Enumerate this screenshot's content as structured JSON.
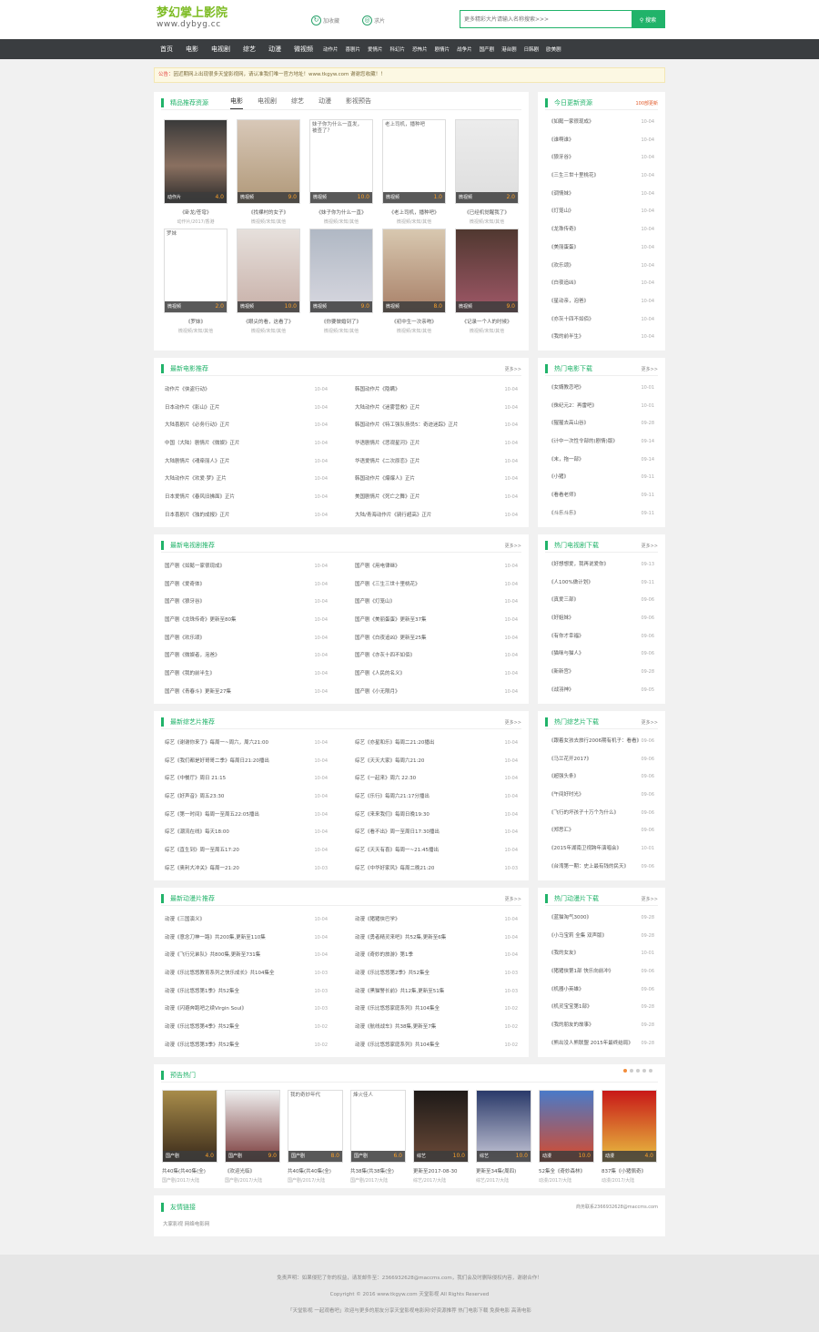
{
  "header": {
    "logo_cn": "梦幻掌上影院",
    "logo_url": "www.dybyg.cc",
    "link1": "加收藏",
    "link2": "求片",
    "search_placeholder": "更多精彩大片请输入名称搜索>>>",
    "search_btn": "搜索"
  },
  "nav": {
    "main": [
      "首页",
      "电影",
      "电视剧",
      "综艺",
      "动漫",
      "微视频"
    ],
    "sub": [
      "动作片",
      "喜剧片",
      "爱情片",
      "科幻片",
      "恐怖片",
      "剧情片",
      "战争片",
      "国产剧",
      "港台剧",
      "日韩剧",
      "欧美剧"
    ]
  },
  "notice": {
    "label": "公告：",
    "text": "因近期网上出现很多天堂影视网，请认准我们唯一官方地址！www.tkgyw.com 谢谢您收藏！！"
  },
  "rec": {
    "title": "精品推荐资源",
    "tabs": [
      "电影",
      "电视剧",
      "综艺",
      "动漫",
      "影视预告"
    ],
    "items": [
      {
        "type": "动作片",
        "score": "4.0",
        "name": "《卧龙/苍穹》",
        "actor": "动作片/2017/香港"
      },
      {
        "type": "微视频",
        "score": "9.0",
        "name": "《找裸村的女子》",
        "actor": "微视频/未知/其他"
      },
      {
        "type": "微视频",
        "score": "10.0",
        "name": "《妹子你为什么一直》",
        "actor": "微视频/未知/其他",
        "alt": "妹子你为什么一直发，被查了？"
      },
      {
        "type": "微视频",
        "score": "1.0",
        "name": "《老上司机，播种吧》",
        "actor": "微视频/未知/其他",
        "alt": "老上司机，播种吧"
      },
      {
        "type": "微视频",
        "score": "2.0",
        "name": "《已经机觉醒我了》",
        "actor": "微视频/未知/其他"
      },
      {
        "type": "微视频",
        "score": "2.0",
        "name": "《罗妹》",
        "actor": "微视频/未知/其他",
        "alt": "罗妹"
      },
      {
        "type": "微视频",
        "score": "10.0",
        "name": "《眼尖的看，这看了》",
        "actor": "微视频/未知/其他"
      },
      {
        "type": "微视频",
        "score": "9.0",
        "name": "《你要做婚到了》",
        "actor": "微视频/未知/其他"
      },
      {
        "type": "微视频",
        "score": "8.0",
        "name": "《初中生一次亲吻》",
        "actor": "微视频/未知/其他"
      },
      {
        "type": "微视频",
        "score": "9.0",
        "name": "《记录一个人的时候》",
        "actor": "微视频/未知/其他"
      }
    ]
  },
  "today": {
    "title": "今日更新资源",
    "count": "100部更新",
    "items": [
      {
        "n": "《如懿一家很现成》",
        "d": "10-04"
      },
      {
        "n": "《谁啊谁》",
        "d": "10-04"
      },
      {
        "n": "《狼牙谷》",
        "d": "10-04"
      },
      {
        "n": "《三生三世十里桃花》",
        "d": "10-04"
      },
      {
        "n": "《调情妹》",
        "d": "10-04"
      },
      {
        "n": "《灯笼山》",
        "d": "10-04"
      },
      {
        "n": "《龙珠传奇》",
        "d": "10-04"
      },
      {
        "n": "《美丽蛋蛋》",
        "d": "10-04"
      },
      {
        "n": "《欢乐颂》",
        "d": "10-04"
      },
      {
        "n": "《白夜追凶》",
        "d": "10-04"
      },
      {
        "n": "《星动亲，泡爸》",
        "d": "10-04"
      },
      {
        "n": "《亦灰十四不如佰》",
        "d": "10-04"
      },
      {
        "n": "《我的前半生》",
        "d": "10-04"
      }
    ]
  },
  "movie": {
    "title": "最新电影推荐",
    "more": "更多>>",
    "items": [
      {
        "n": "动作片《侠盗行动》",
        "d": "10-04"
      },
      {
        "n": "韩国动作片《隐瞒》",
        "d": "10-04"
      },
      {
        "n": "日本动作片《影山》正片",
        "d": "10-04"
      },
      {
        "n": "大陆动作片《迷雾营救》正片",
        "d": "10-04"
      },
      {
        "n": "大陆喜剧片《必务行动》正片",
        "d": "10-04"
      },
      {
        "n": "韩国动作片《特工强队扬员5：奇迹迷踪》正片",
        "d": "10-04"
      },
      {
        "n": "中国（大陆）剧情片《微娱》正片",
        "d": "10-04"
      },
      {
        "n": "华语剧情片《悲观星河》正片",
        "d": "10-04"
      },
      {
        "n": "大陆剧情片《魂牵丽人》正片",
        "d": "10-04"
      },
      {
        "n": "华语爱情片《二次原恋》正片",
        "d": "10-04"
      },
      {
        "n": "大陆动作片《欢爱·梦》正片",
        "d": "10-04"
      },
      {
        "n": "韩国动作片《爆爆人》正片",
        "d": "10-04"
      },
      {
        "n": "日本爱情片《春风旧拂面》正片",
        "d": "10-04"
      },
      {
        "n": "美国剧情片《死亡之舞》正片",
        "d": "10-04"
      },
      {
        "n": "日本喜剧片《独的成报》正片",
        "d": "10-04"
      },
      {
        "n": "大陆/青海动作片《骑行超高》正片",
        "d": "10-04"
      }
    ]
  },
  "movieHot": {
    "title": "热门电影下载",
    "more": "更多>>",
    "items": [
      {
        "n": "《女婿教恋吧》",
        "d": "10-01"
      },
      {
        "n": "《侏纪元2：再雷吧》",
        "d": "10-01"
      },
      {
        "n": "《猩猩去高山谷》",
        "d": "09-28"
      },
      {
        "n": "《计中一次性令部的(剧情)版》",
        "d": "09-14"
      },
      {
        "n": "《末，拖一部》",
        "d": "09-14"
      },
      {
        "n": "《小猪》",
        "d": "09-11"
      },
      {
        "n": "《看看老师》",
        "d": "09-11"
      },
      {
        "n": "《斗乐斗乐》",
        "d": "09-11"
      }
    ]
  },
  "tv": {
    "title": "最新电视剧推荐",
    "more": "更多>>",
    "items": [
      {
        "n": "国产剧《如懿一家很现成》",
        "d": "10-04"
      },
      {
        "n": "国产剧《用电律继》",
        "d": "10-04"
      },
      {
        "n": "国产剧《爱奇体》",
        "d": "10-04"
      },
      {
        "n": "国产剧《三生三世十里桃花》",
        "d": "10-04"
      },
      {
        "n": "国产剧《狼牙谷》",
        "d": "10-04"
      },
      {
        "n": "国产剧《灯笼山》",
        "d": "10-04"
      },
      {
        "n": "国产剧《龙珠传奇》更新至80集",
        "d": "10-04"
      },
      {
        "n": "国产剧《美丽蛋蛋》更新至37集",
        "d": "10-04"
      },
      {
        "n": "国产剧《欢乐颂》",
        "d": "10-04"
      },
      {
        "n": "国产剧《白夜追凶》更新至25集",
        "d": "10-04"
      },
      {
        "n": "国产剧《微娱者，泡爸》",
        "d": "10-04"
      },
      {
        "n": "国产剧《亦灰十四不如佰》",
        "d": "10-04"
      },
      {
        "n": "国产剧《我的前半生》",
        "d": "10-04"
      },
      {
        "n": "国产剧《人民的名义》",
        "d": "10-04"
      },
      {
        "n": "国产剧《青春斗》更新至27集",
        "d": "10-04"
      },
      {
        "n": "国产剧《小无限月》",
        "d": "10-04"
      }
    ]
  },
  "tvHot": {
    "title": "热门电视剧下载",
    "more": "更多>>",
    "items": [
      {
        "n": "《好想想爱，我再说爱你》",
        "d": "09-13"
      },
      {
        "n": "《人100%做计划》",
        "d": "09-11"
      },
      {
        "n": "《真爱三部》",
        "d": "09-06"
      },
      {
        "n": "《好姐妹》",
        "d": "09-06"
      },
      {
        "n": "《有你才幸福》",
        "d": "09-06"
      },
      {
        "n": "《猫咪与猫人》",
        "d": "09-06"
      },
      {
        "n": "《新新宫》",
        "d": "09-28"
      },
      {
        "n": "《战羽神》",
        "d": "09-05"
      }
    ]
  },
  "variety": {
    "title": "最新综艺片推荐",
    "more": "更多>>",
    "items": [
      {
        "n": "综艺《谢谢你来了》每周一~周六，周六21:00",
        "d": "10-04"
      },
      {
        "n": "综艺《亦星和乐》每周二21:20播出",
        "d": "10-04"
      },
      {
        "n": "综艺《我们都是好哥哥二季》每周日21:20播出",
        "d": "10-04"
      },
      {
        "n": "综艺《天天大家》每周六21:20",
        "d": "10-04"
      },
      {
        "n": "综艺《中餐厅》周日 21:15",
        "d": "10-04"
      },
      {
        "n": "综艺《一起来》周六 22:30",
        "d": "10-04"
      },
      {
        "n": "综艺《好声音》周五23:30",
        "d": "10-04"
      },
      {
        "n": "综艺《乐行》每周六21:17分播出",
        "d": "10-04"
      },
      {
        "n": "综艺《第一时间》每周一至周五22:05播出",
        "d": "10-04"
      },
      {
        "n": "综艺《来来我们》每周日晚19:30",
        "d": "10-04"
      },
      {
        "n": "综艺《潮流在线》每天18:00",
        "d": "10-04"
      },
      {
        "n": "综艺《看不出》周一至周日17:30播出",
        "d": "10-04"
      },
      {
        "n": "综艺《直生到》周一至周五17:20",
        "d": "10-04"
      },
      {
        "n": "综艺《天天有喜》每周一~21:45播出",
        "d": "10-04"
      },
      {
        "n": "综艺《奥利大冲关》每周一21:20",
        "d": "10-03"
      },
      {
        "n": "综艺《中华好家风》每周二晚21:20",
        "d": "10-03"
      }
    ]
  },
  "varietyHot": {
    "title": "热门综艺片下载",
    "more": "更多>>",
    "items": [
      {
        "n": "《跟着女孩去旅行2006期有机子：看看》",
        "d": "09-06"
      },
      {
        "n": "《马兰花开2017》",
        "d": "09-06"
      },
      {
        "n": "《超强头条》",
        "d": "09-06"
      },
      {
        "n": "《午间好时光》",
        "d": "09-06"
      },
      {
        "n": "《飞行的坏孩子十万个为什么》",
        "d": "09-06"
      },
      {
        "n": "《郑思汇》",
        "d": "09-06"
      },
      {
        "n": "《2015年湖南卫视跨年演唱会》",
        "d": "10-01"
      },
      {
        "n": "《台湾第一期：史上最有钱的民天》",
        "d": "09-06"
      }
    ]
  },
  "anime": {
    "title": "最新动漫片推荐",
    "more": "更多>>",
    "items": [
      {
        "n": "动漫《三国演义》",
        "d": "10-04"
      },
      {
        "n": "动漫《猪猪侠巴学》",
        "d": "10-04"
      },
      {
        "n": "动漫《意念刀神一路》共200集,更新至110集",
        "d": "10-04"
      },
      {
        "n": "动漫《勇者精灵来吧》共52集,更新至6集",
        "d": "10-04"
      },
      {
        "n": "动漫《飞行兄弟队》共800集,更新至731集",
        "d": "10-04"
      },
      {
        "n": "动漫《奇妙的旅游》第1季",
        "d": "10-04"
      },
      {
        "n": "动漫《乐比悠悠教育系列之快乐成长》共104集全",
        "d": "10-03"
      },
      {
        "n": "动漫《乐比悠悠第2季》共52集全",
        "d": "10-03"
      },
      {
        "n": "动漫《乐比悠悠第1季》共52集全",
        "d": "10-03"
      },
      {
        "n": "动漫《黑猫警长前》共12集,更新至51集",
        "d": "10-03"
      },
      {
        "n": "动漫《闪避奔跑吧之续Virgin Soul》",
        "d": "10-03"
      },
      {
        "n": "动漫《乐比悠悠家庭系列》共104集全",
        "d": "10-02"
      },
      {
        "n": "动漫《乐比悠悠第4季》共52集全",
        "d": "10-02"
      },
      {
        "n": "动漫《航线战车》共38集,更新至7集",
        "d": "10-02"
      },
      {
        "n": "动漫《乐比悠悠第3季》共52集全",
        "d": "10-02"
      },
      {
        "n": "动漫《乐比悠悠家庭系列》共104集全",
        "d": "10-02"
      }
    ]
  },
  "animeHot": {
    "title": "热门动漫片下载",
    "more": "更多>>",
    "items": [
      {
        "n": "《蓝猫淘气3000》",
        "d": "09-28"
      },
      {
        "n": "《小马宝莉 全集 双声版》",
        "d": "09-28"
      },
      {
        "n": "《我的女友》",
        "d": "10-01"
      },
      {
        "n": "《猪猪侠第1部 快乐向前冲》",
        "d": "09-06"
      },
      {
        "n": "《机器小英雄》",
        "d": "09-06"
      },
      {
        "n": "《机灵宝宝第1部》",
        "d": "09-28"
      },
      {
        "n": "《我的朋友的故事》",
        "d": "09-28"
      },
      {
        "n": "《熊出没人熊联盟 2015年最终结局》",
        "d": "09-28"
      }
    ]
  },
  "preview": {
    "title": "预告热门",
    "items": [
      {
        "type": "国产剧",
        "score": "4.0",
        "name": "共40集(共40集(全)",
        "actor": "国产剧/2017/大陆"
      },
      {
        "type": "国产剧",
        "score": "9.0",
        "name": "《欢迎光临》",
        "actor": "国产剧/2017/大陆"
      },
      {
        "type": "国产剧",
        "score": "8.0",
        "name": "共40集(共40集(全)",
        "actor": "国产剧/2017/大陆",
        "alt": "我的奇妙年代"
      },
      {
        "type": "国产剧",
        "score": "6.0",
        "name": "共38集(共38集(全)",
        "actor": "国产剧/2017/大陆",
        "alt": "烽火佳人"
      },
      {
        "type": "综艺",
        "score": "10.0",
        "name": "更新至2017-08-30",
        "actor": "综艺/2017/大陆"
      },
      {
        "type": "综艺",
        "score": "10.0",
        "name": "更新至34集(周四)",
        "actor": "综艺/2017/大陆"
      },
      {
        "type": "动漫",
        "score": "10.0",
        "name": "52集全《奇妙森林》",
        "actor": "动漫/2017/大陆"
      },
      {
        "type": "动漫",
        "score": "4.0",
        "name": "837集《小猪佩奇》",
        "actor": "动漫/2017/大陆"
      }
    ]
  },
  "links": {
    "title": "友情链接",
    "contact": "商务联系2366932628@maccms.com",
    "text": "大家影视  网络电影网"
  },
  "footer": {
    "l1": "免责声明：如果侵犯了你的权益，请发邮件至：2366932628@maccms.com，我们会及时删除侵权内容，谢谢合作！",
    "l2": "Copyright © 2016 www.tkgyw.com 天堂影视 All Rights Reserved",
    "l3": "「天堂影视  一起观看吧」欢迎与更多的朋友分享天堂影视电影网!好资源推荐 热门电影下载 免费电影 高清电影"
  }
}
